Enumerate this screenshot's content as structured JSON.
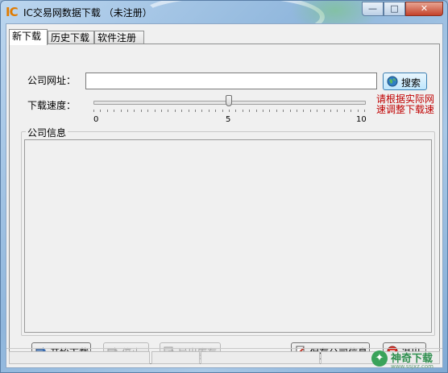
{
  "window": {
    "logo_text": "IC",
    "title": "IC交易网数据下载  （未注册）",
    "min_glyph": "—",
    "max_glyph": "□",
    "close_glyph": "✕"
  },
  "tabs": [
    {
      "label": "新下载",
      "active": true
    },
    {
      "label": "历史下载",
      "active": false
    },
    {
      "label": "软件注册",
      "active": false
    }
  ],
  "form": {
    "url_label": "公司网址：",
    "url_value": "",
    "search_label": "搜索",
    "speed_label": "下载速度：",
    "speed_value": 5,
    "speed_min": 0,
    "speed_max": 10,
    "tick_min_label": "0",
    "tick_mid_label": "5",
    "tick_max_label": "10",
    "hint": "请根据实际网速调整下载速"
  },
  "info": {
    "group_title": "公司信息",
    "content": ""
  },
  "actions": {
    "start_label": "开始下载",
    "stop_label": "停止",
    "export_label": "导出库存",
    "save_label": "保存公司信息",
    "exit_label": "退出"
  },
  "status": {
    "progress": 0
  },
  "watermark": {
    "name": "神奇下载",
    "sub": "www.ssjxz.com"
  },
  "colors": {
    "hint": "#c00000",
    "logo": "#e07b00"
  }
}
